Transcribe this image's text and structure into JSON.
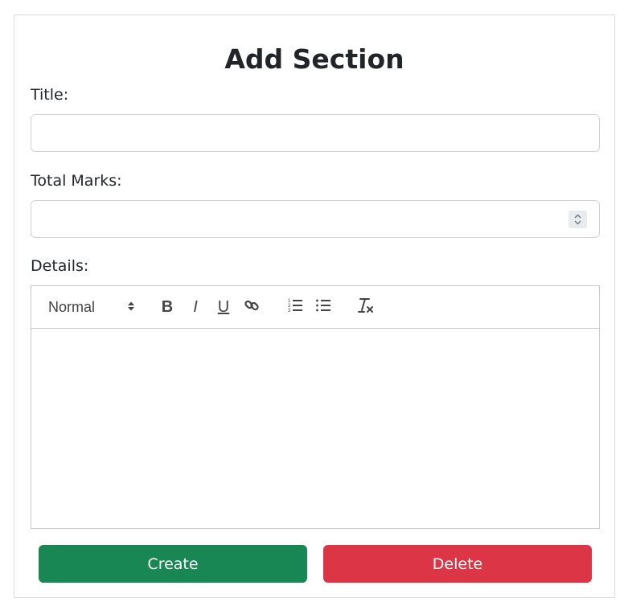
{
  "form": {
    "heading": "Add Section",
    "title_label": "Title:",
    "title_value": "",
    "marks_label": "Total Marks:",
    "marks_value": "",
    "details_label": "Details:"
  },
  "editor": {
    "heading_select_value": "Normal",
    "bold_label": "B",
    "italic_label": "I",
    "underline_label": "U",
    "tools": [
      "heading-select",
      "bold-icon",
      "italic-icon",
      "underline-icon",
      "link-icon",
      "ordered-list-icon",
      "bullet-list-icon",
      "clear-format-icon"
    ],
    "content": ""
  },
  "actions": {
    "create_label": "Create",
    "delete_label": "Delete"
  },
  "colors": {
    "create": "#198754",
    "delete": "#dc3545",
    "text": "#212529",
    "border": "#ced4da"
  }
}
